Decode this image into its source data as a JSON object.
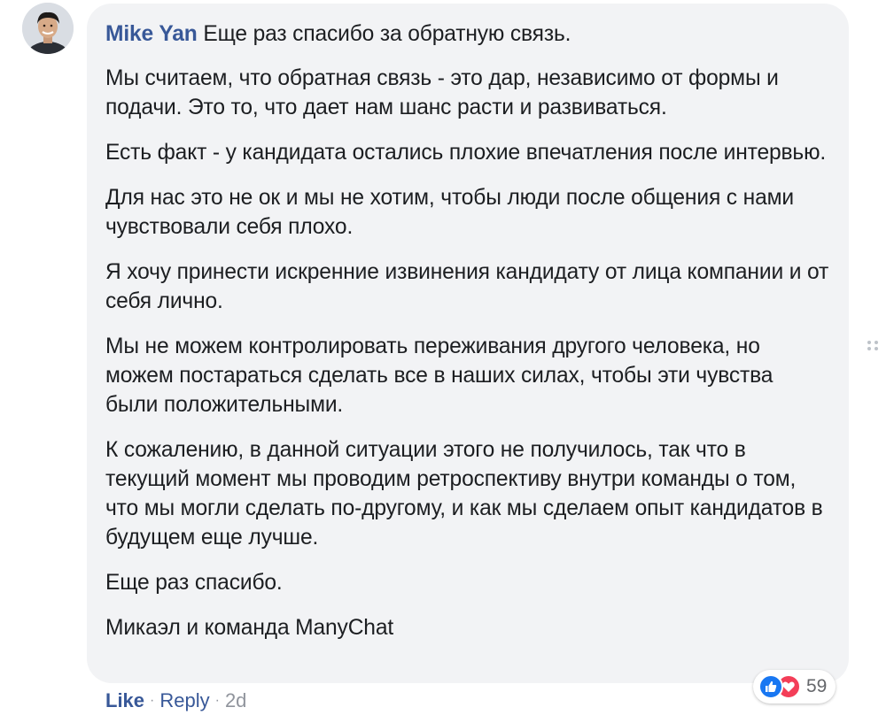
{
  "comment": {
    "author": "Mike Yan",
    "first_line": "Еще раз спасибо за обратную связь.",
    "paragraphs": [
      "Мы считаем, что обратная связь - это дар, независимо от формы и подачи. Это то, что дает нам шанс расти и развиваться.",
      "Есть факт - у кандидата остались плохие впечатления после интервью.",
      "Для нас это не ок и мы не хотим, чтобы люди после общения с нами чувствовали себя плохо.",
      "Я хочу принести искренние извинения кандидату от лица компании и от себя лично.",
      "Мы не можем контролировать переживания другого человека, но можем постараться сделать все в наших силах, чтобы эти чувства были положительными.",
      "К сожалению, в данной ситуации этого не получилось, так что в текущий момент мы проводим ретроспективу внутри команды о том, что мы могли сделать по-другому, и как мы сделаем опыт кандидатов в будущем еще лучше.",
      "Еще раз спасибо.",
      "Микаэл и команда ManyChat"
    ]
  },
  "actions": {
    "like_label": "Like",
    "reply_label": "Reply",
    "separator": "·",
    "timestamp": "2d"
  },
  "reactions": {
    "count": "59",
    "icons": [
      "like-icon",
      "love-icon"
    ]
  },
  "colors": {
    "bubble_bg": "#f2f3f5",
    "link": "#385898",
    "meta": "#90949c",
    "like_blue": "#1877f2",
    "love_red": "#f33e58"
  }
}
